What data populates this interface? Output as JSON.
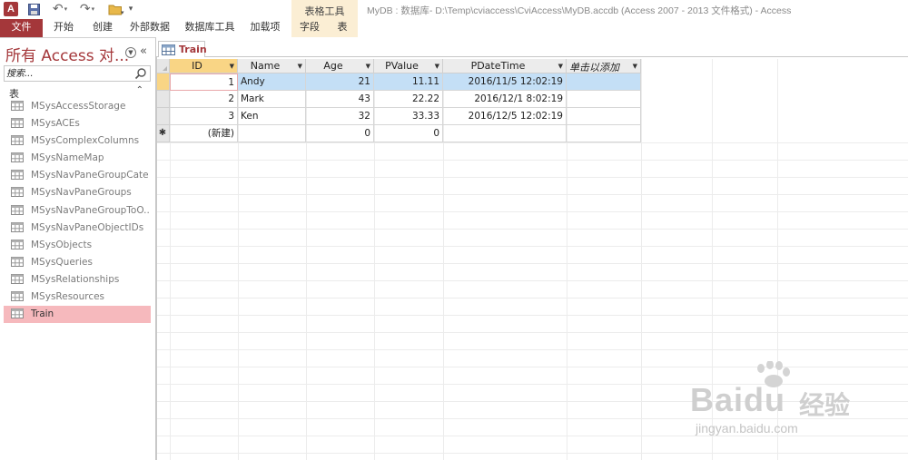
{
  "window": {
    "title": "MyDB : 数据库- D:\\Temp\\cviaccess\\CviAccess\\MyDB.accdb (Access 2007 - 2013 文件格式) - Access",
    "app_icon_text": "A",
    "contextual_group": "表格工具"
  },
  "quick_access": {
    "icons": [
      "access-app-icon",
      "save-icon",
      "undo-icon",
      "redo-icon",
      "open-folder-icon",
      "customize-qat-icon"
    ]
  },
  "ribbon": {
    "tabs": {
      "file": "文件",
      "home": "开始",
      "create": "创建",
      "external": "外部数据",
      "dbtools": "数据库工具",
      "addins": "加载项",
      "fields": "字段",
      "table": "表"
    }
  },
  "nav": {
    "title": "所有 Access 对...",
    "search_placeholder": "搜索...",
    "group_label": "表",
    "group_toggle": "⌃",
    "items": [
      {
        "label": "MSysAccessStorage"
      },
      {
        "label": "MSysACEs"
      },
      {
        "label": "MSysComplexColumns"
      },
      {
        "label": "MSysNameMap"
      },
      {
        "label": "MSysNavPaneGroupCate..."
      },
      {
        "label": "MSysNavPaneGroups"
      },
      {
        "label": "MSysNavPaneGroupToO..."
      },
      {
        "label": "MSysNavPaneObjectIDs"
      },
      {
        "label": "MSysObjects"
      },
      {
        "label": "MSysQueries"
      },
      {
        "label": "MSysRelationships"
      },
      {
        "label": "MSysResources"
      },
      {
        "label": "Train"
      }
    ],
    "selected_index": 12
  },
  "document": {
    "tab_label": "Train"
  },
  "datasheet": {
    "columns": [
      "ID",
      "Name",
      "Age",
      "PValue",
      "PDateTime",
      "单击以添加"
    ],
    "rows": [
      {
        "id": "1",
        "name": "Andy",
        "age": "21",
        "pvalue": "11.11",
        "pdatetime": "2016/11/5 12:02:19"
      },
      {
        "id": "2",
        "name": "Mark",
        "age": "43",
        "pvalue": "22.22",
        "pdatetime": "2016/12/1 8:02:19"
      },
      {
        "id": "3",
        "name": "Ken",
        "age": "32",
        "pvalue": "33.33",
        "pdatetime": "2016/12/5 12:02:19"
      }
    ],
    "new_row": {
      "marker": "✱",
      "id": "(新建)",
      "age": "0",
      "pvalue": "0"
    }
  },
  "watermark": {
    "brand": "Bai",
    "brand_suffix": "du",
    "cn": "经验",
    "url": "jingyan.baidu.com"
  }
}
